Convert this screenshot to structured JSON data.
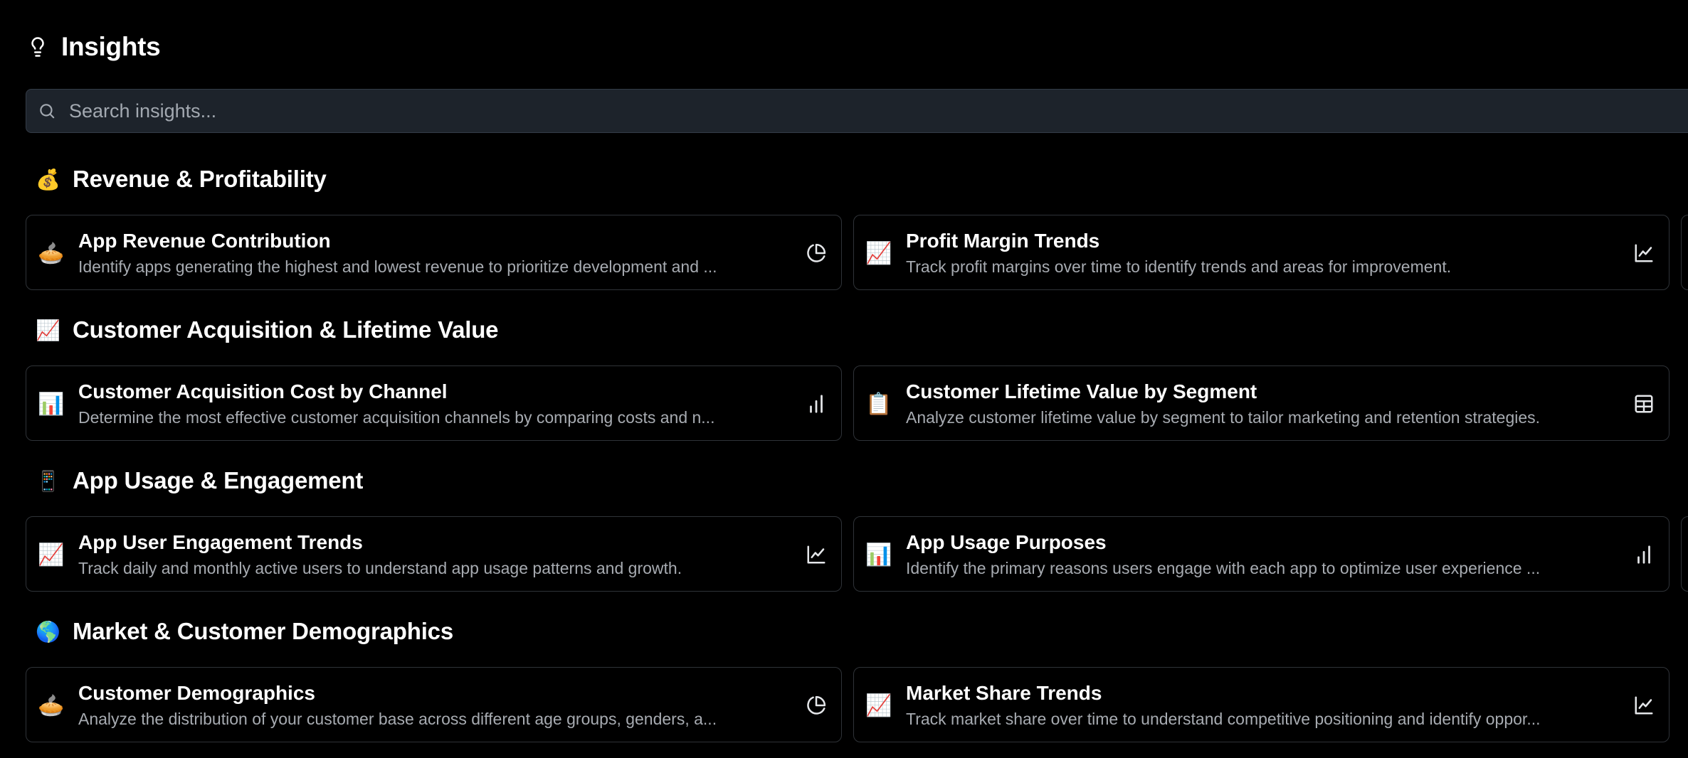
{
  "header": {
    "title": "Insights",
    "icon": "lightbulb-icon"
  },
  "search": {
    "placeholder": "Search insights...",
    "value": ""
  },
  "sections": [
    {
      "emoji": "💰",
      "title": "Revenue & Profitability",
      "cards": [
        {
          "emoji": "🥧",
          "title": "App Revenue Contribution",
          "description": "Identify apps generating the highest and lowest revenue to prioritize development and ...",
          "type_icon": "pie-chart-icon"
        },
        {
          "emoji": "📈",
          "title": "Profit Margin Trends",
          "description": "Track profit margins over time to identify trends and areas for improvement.",
          "type_icon": "line-chart-icon"
        }
      ]
    },
    {
      "emoji": "📈",
      "title": "Customer Acquisition & Lifetime Value",
      "cards": [
        {
          "emoji": "📊",
          "title": "Customer Acquisition Cost by Channel",
          "description": "Determine the most effective customer acquisition channels by comparing costs and n...",
          "type_icon": "bar-chart-icon"
        },
        {
          "emoji": "📋",
          "title": "Customer Lifetime Value by Segment",
          "description": "Analyze customer lifetime value by segment to tailor marketing and retention strategies.",
          "type_icon": "table-icon"
        }
      ]
    },
    {
      "emoji": "📱",
      "title": "App Usage & Engagement",
      "cards": [
        {
          "emoji": "📈",
          "title": "App User Engagement Trends",
          "description": "Track daily and monthly active users to understand app usage patterns and growth.",
          "type_icon": "line-chart-icon"
        },
        {
          "emoji": "📊",
          "title": "App Usage Purposes",
          "description": "Identify the primary reasons users engage with each app to optimize user experience ...",
          "type_icon": "bar-chart-icon"
        }
      ]
    },
    {
      "emoji": "🌎",
      "title": "Market & Customer Demographics",
      "cards": [
        {
          "emoji": "🥧",
          "title": "Customer Demographics",
          "description": "Analyze the distribution of your customer base across different age groups, genders, a...",
          "type_icon": "pie-chart-icon"
        },
        {
          "emoji": "📈",
          "title": "Market Share Trends",
          "description": "Track market share over time to understand competitive positioning and identify oppor...",
          "type_icon": "line-chart-icon"
        }
      ]
    }
  ],
  "colors": {
    "background": "#000000",
    "search_background": "#1d232b",
    "card_border": "#2f3338",
    "description_text": "#a7abb1"
  }
}
